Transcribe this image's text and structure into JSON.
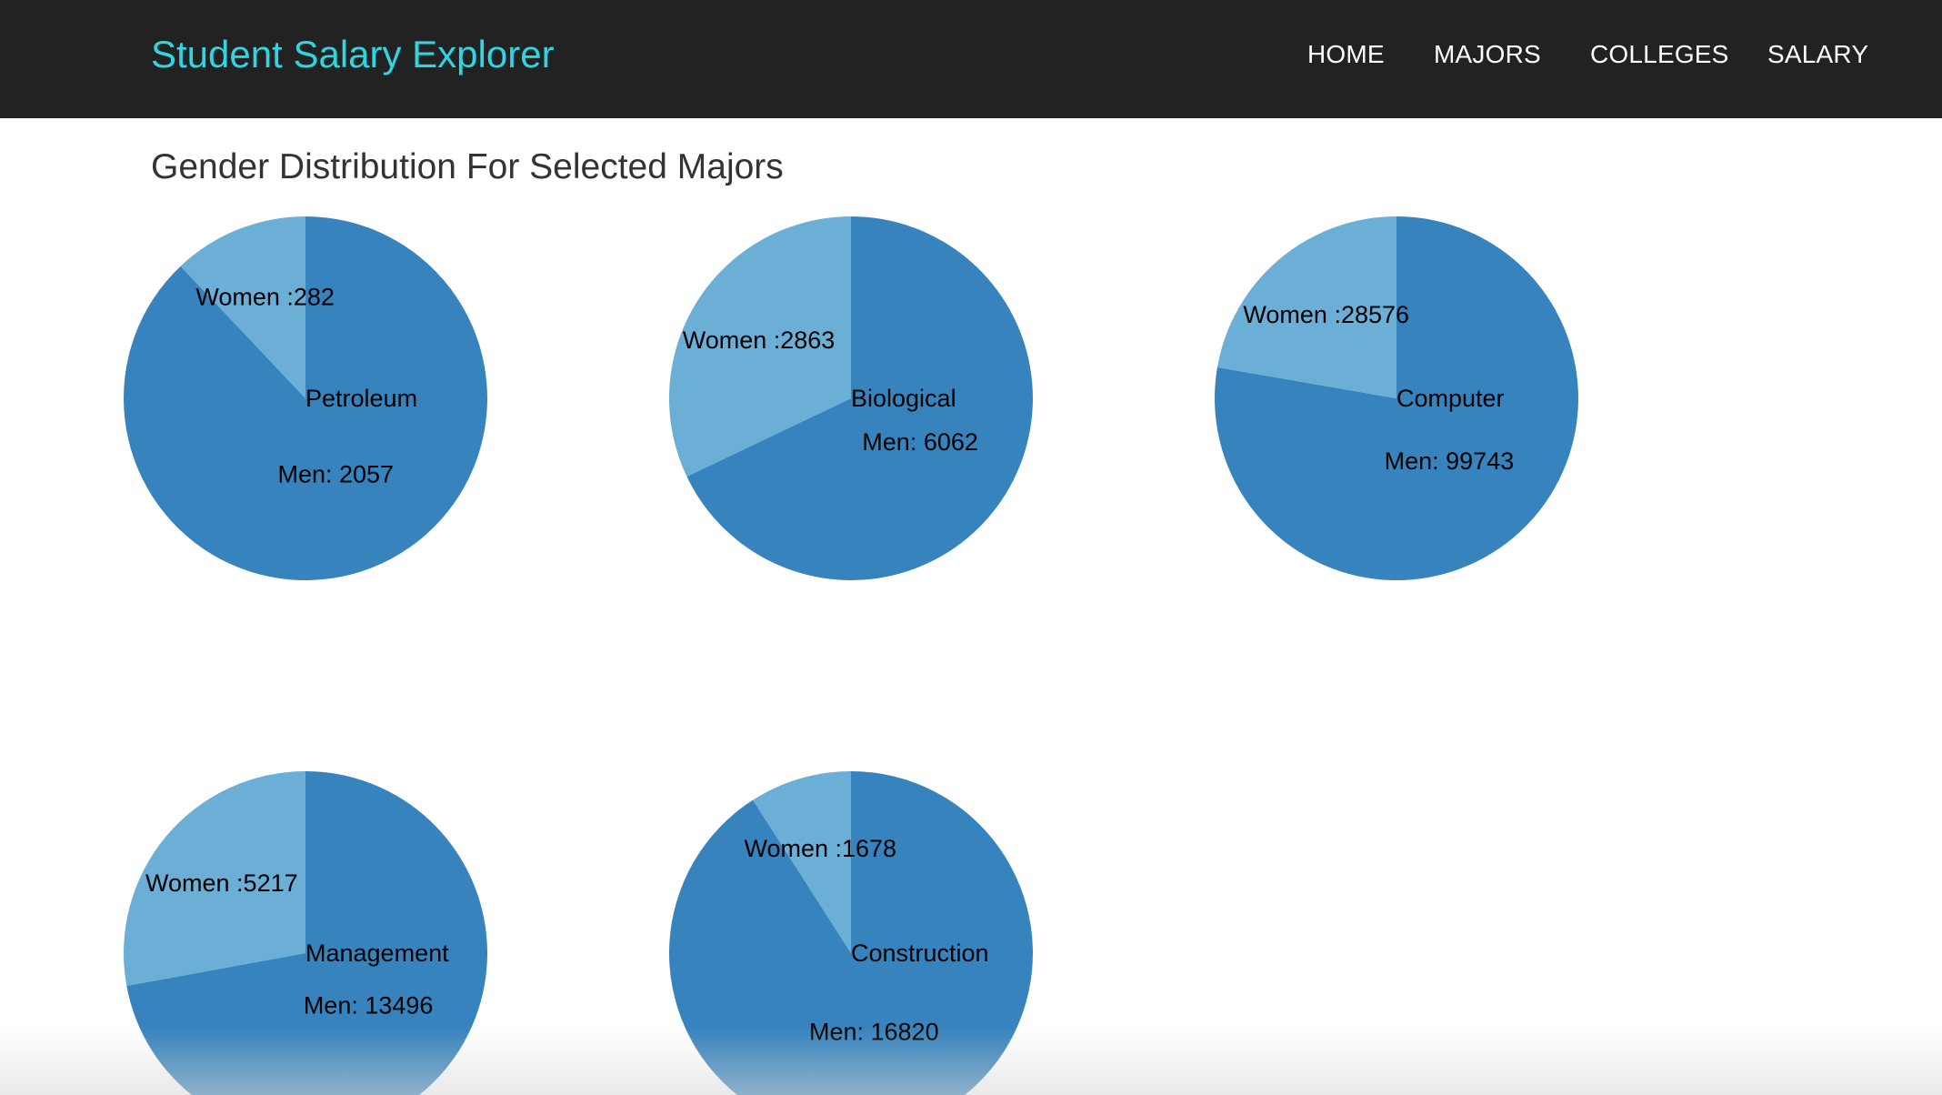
{
  "navbar": {
    "brand": "Student Salary Explorer",
    "items": [
      {
        "label": "HOME"
      },
      {
        "label": "MAJORS"
      },
      {
        "label": "COLLEGES"
      },
      {
        "label": "SALARY"
      }
    ]
  },
  "page": {
    "title": "Gender Distribution For Selected Majors"
  },
  "colors": {
    "navbar_bg": "#222222",
    "brand": "#2fd5e2",
    "men": "#3783bd",
    "women": "#6baed6"
  },
  "chart_data": [
    {
      "type": "pie",
      "title": "Petroleum",
      "slices": [
        {
          "label": "Women :282",
          "value": 282
        },
        {
          "label": "Men: 2057",
          "value": 2057
        }
      ]
    },
    {
      "type": "pie",
      "title": "Biological",
      "slices": [
        {
          "label": "Women :2863",
          "value": 2863
        },
        {
          "label": "Men: 6062",
          "value": 6062
        }
      ]
    },
    {
      "type": "pie",
      "title": "Computer",
      "slices": [
        {
          "label": "Women :28576",
          "value": 28576
        },
        {
          "label": "Men: 99743",
          "value": 99743
        }
      ]
    },
    {
      "type": "pie",
      "title": "Management",
      "slices": [
        {
          "label": "Women :5217",
          "value": 5217
        },
        {
          "label": "Men: 13496",
          "value": 13496
        }
      ]
    },
    {
      "type": "pie",
      "title": "Construction",
      "slices": [
        {
          "label": "Women :1678",
          "value": 1678
        },
        {
          "label": "Men: 16820",
          "value": 16820
        }
      ]
    }
  ]
}
